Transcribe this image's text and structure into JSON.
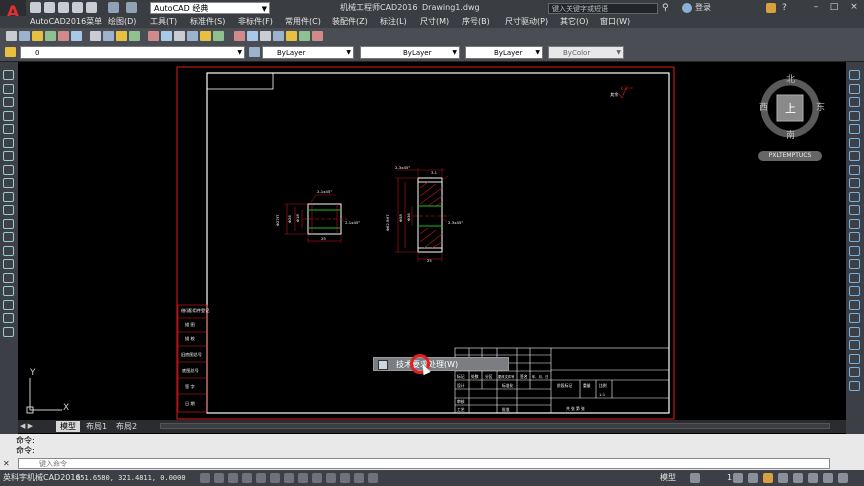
{
  "app": {
    "logo_letter": "A",
    "workspace": "AutoCAD 经典",
    "app_title": "机械工程师CAD2016",
    "doc_title": "Drawing1.dwg",
    "search_placeholder": "键入关键字或短语",
    "login": "登录",
    "window_min": "–",
    "window_max": "□",
    "window_close": "×"
  },
  "menu": [
    "AutoCAD2016菜单",
    "绘图(D)",
    "工具(T)",
    "标准件(S)",
    "非标件(F)",
    "常用件(C)",
    "装配件(Z)",
    "标注(L)",
    "尺寸(M)",
    "序号(B)",
    "尺寸驱动(P)",
    "其它(O)",
    "窗口(W)"
  ],
  "layer_bar": {
    "layer_name": "0",
    "color": "ByLayer",
    "linetype": "ByLayer",
    "lineweight": "ByLayer",
    "plotstyle": "ByColor"
  },
  "viewcube": {
    "north": "北",
    "south": "南",
    "east": "东",
    "west": "西",
    "top": "上",
    "ucs": "PXLTEMPTUCS"
  },
  "drawing": {
    "left_part": {
      "chamfer_top": "2-1x45°",
      "chamfer_right": "2-1x45°",
      "dim_left_1": "Φ27f7",
      "dim_left_2": "Φ26",
      "dim_left_3": "Φ18",
      "dim_bottom": "25"
    },
    "right_part": {
      "chamfer_top": "2-3x45°",
      "chamfer_right": "2-3x45°",
      "dim_top": "3.1",
      "dim_left_1": "Φ62.9H7",
      "dim_left_2": "Φ58",
      "dim_left_3": "Φ36",
      "dim_bottom": "25"
    },
    "roughness_note": "其余",
    "roughness_value": "6.3",
    "left_table": [
      "借(通)用件登记",
      "描  图",
      "描  校",
      "旧底图总号",
      "底图总号",
      "签  字",
      "日  期"
    ],
    "title_block": {
      "row1": [
        "标记",
        "处数",
        "分区",
        "更改文件号",
        "签名",
        "年、月、日"
      ],
      "row2": [
        "设计",
        "标准化"
      ],
      "stage_label": "阶段标记",
      "weight_label": "重量",
      "scale_label": "比例",
      "scale_value": "1:1",
      "row4": [
        "审核"
      ],
      "row5": [
        "工艺",
        "批准"
      ],
      "sheet_label": "共  张 第  张"
    }
  },
  "tooltip": {
    "text": "技术要求处理(W)"
  },
  "ucs_icon": {
    "x": "X",
    "y": "Y"
  },
  "tabs": [
    "模型",
    "布局1",
    "布局2"
  ],
  "command": {
    "line1": "命令:",
    "line2": "命令:",
    "input_placeholder": "键入命令"
  },
  "status": {
    "app_name": "英科宇机械CAD2016",
    "coords": "251.6580, 321.4811, 0.0000",
    "model": "模型",
    "scale": "1:1"
  },
  "colors": {
    "frame_red": "#e01b1b",
    "paper_white": "#ffffff",
    "dim_red": "#e01b1b",
    "center_green": "#19c019",
    "hatch_red": "#c01818",
    "title_bar": "#3a3d42"
  }
}
